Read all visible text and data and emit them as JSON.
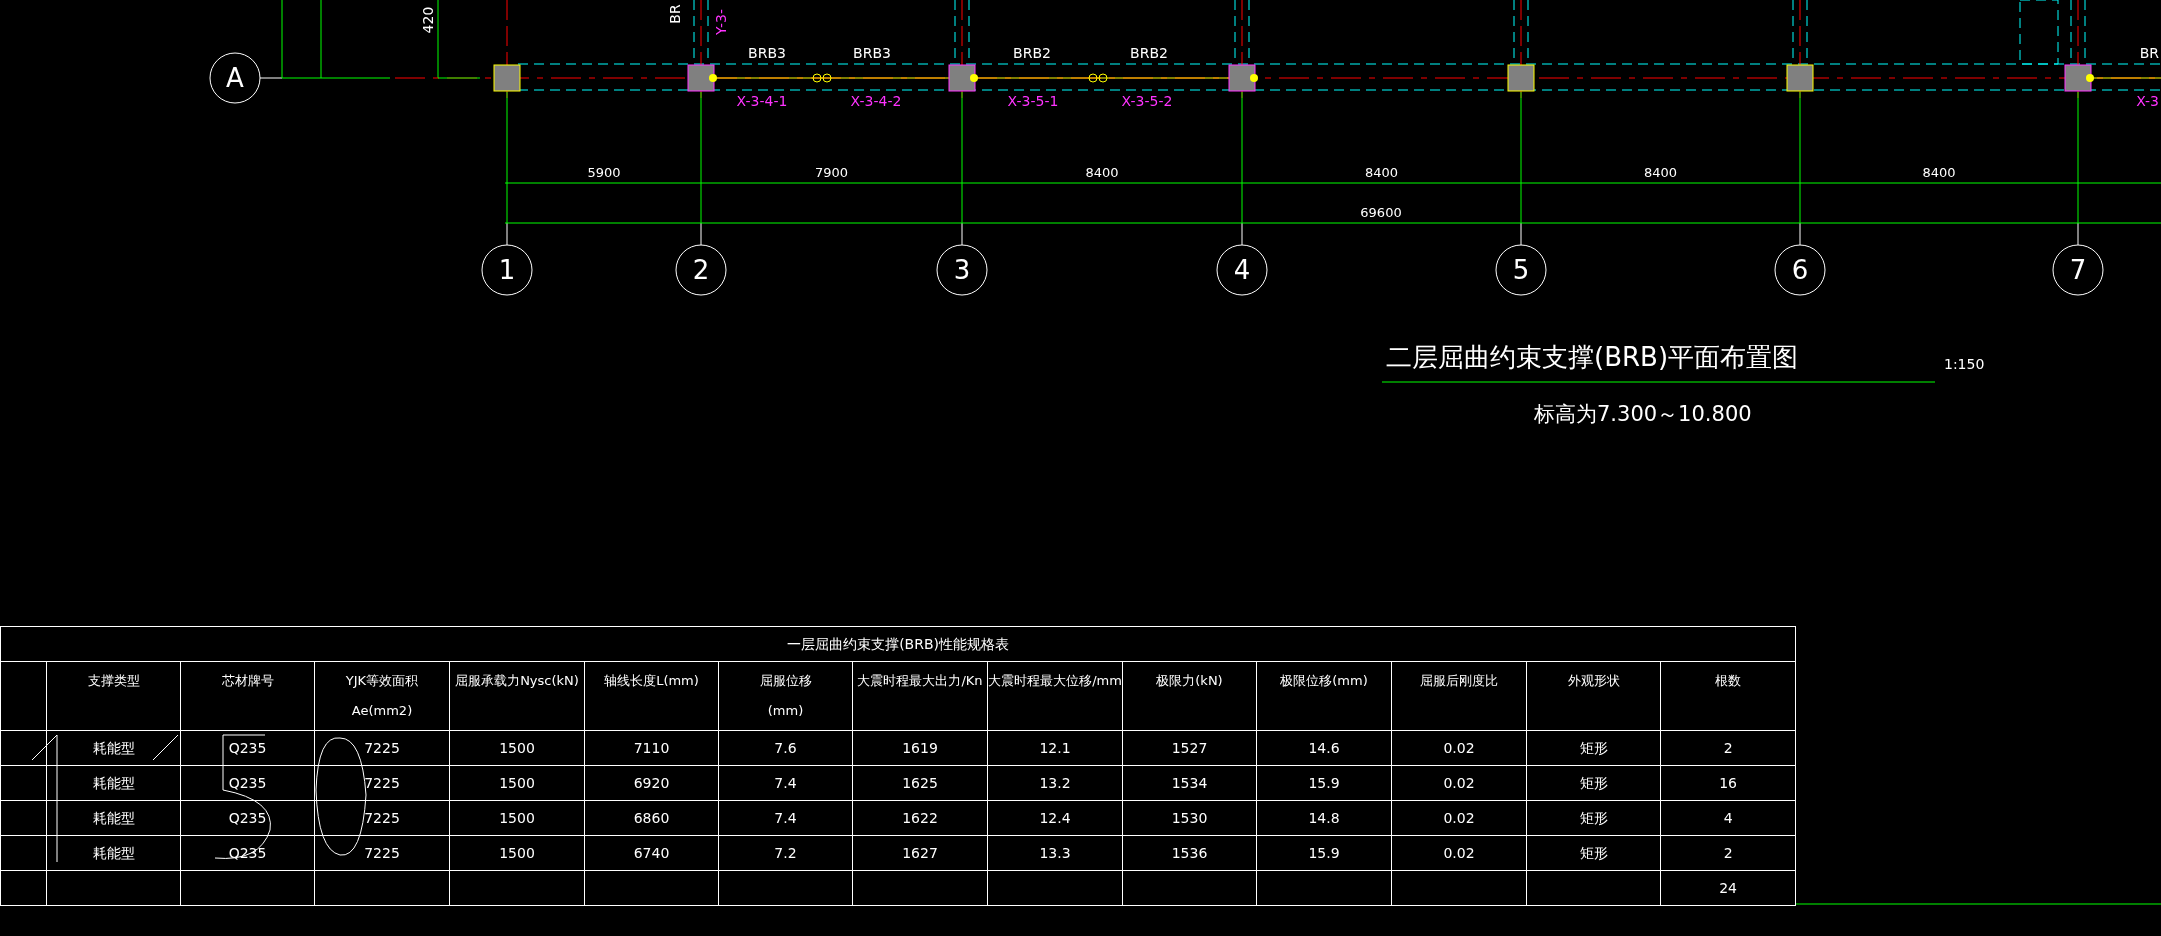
{
  "plan": {
    "row_axis": "A",
    "dimension_cut": "420",
    "vertical_brace_label_cut": "BR",
    "vertical_brace_id_cut": "Y-3-",
    "brace_labels": [
      "BRB3",
      "BRB3",
      "BRB2",
      "BRB2",
      "BR"
    ],
    "brace_ids": [
      "X-3-4-1",
      "X-3-4-2",
      "X-3-5-1",
      "X-3-5-2",
      "X-3"
    ],
    "spans": [
      "5900",
      "7900",
      "8400",
      "8400",
      "8400",
      "8400"
    ],
    "total": "69600",
    "column_axes": [
      "1",
      "2",
      "3",
      "4",
      "5",
      "6",
      "7"
    ]
  },
  "title": "二层屈曲约束支撑(BRB)平面布置图",
  "scale": "1:150",
  "elevation": "标高为7.300～10.800",
  "table": {
    "title": "一层屈曲约束支撑(BRB)性能规格表",
    "columns": [
      "",
      "支撑类型",
      "芯材牌号",
      "YJK等效面积\nAe(mm2)",
      "屈服承载力Nysc(kN)",
      "轴线长度L(mm)",
      "屈服位移\n(mm)",
      "大震时程最大出力/Kn",
      "大震时程最大位移/mm",
      "极限力(kN)",
      "极限位移(mm)",
      "屈服后刚度比",
      "外观形状",
      "根数"
    ],
    "rows": [
      [
        "",
        "耗能型",
        "Q235",
        "7225",
        "1500",
        "7110",
        "7.6",
        "1619",
        "12.1",
        "1527",
        "14.6",
        "0.02",
        "矩形",
        "2"
      ],
      [
        "",
        "耗能型",
        "Q235",
        "7225",
        "1500",
        "6920",
        "7.4",
        "1625",
        "13.2",
        "1534",
        "15.9",
        "0.02",
        "矩形",
        "16"
      ],
      [
        "",
        "耗能型",
        "Q235",
        "7225",
        "1500",
        "6860",
        "7.4",
        "1622",
        "12.4",
        "1530",
        "14.8",
        "0.02",
        "矩形",
        "4"
      ],
      [
        "",
        "耗能型",
        "Q235",
        "7225",
        "1500",
        "6740",
        "7.2",
        "1627",
        "13.3",
        "1536",
        "15.9",
        "0.02",
        "矩形",
        "2"
      ],
      [
        "",
        "",
        "",
        "",
        "",
        "",
        "",
        "",
        "",
        "",
        "",
        "",
        "",
        "24"
      ]
    ]
  }
}
